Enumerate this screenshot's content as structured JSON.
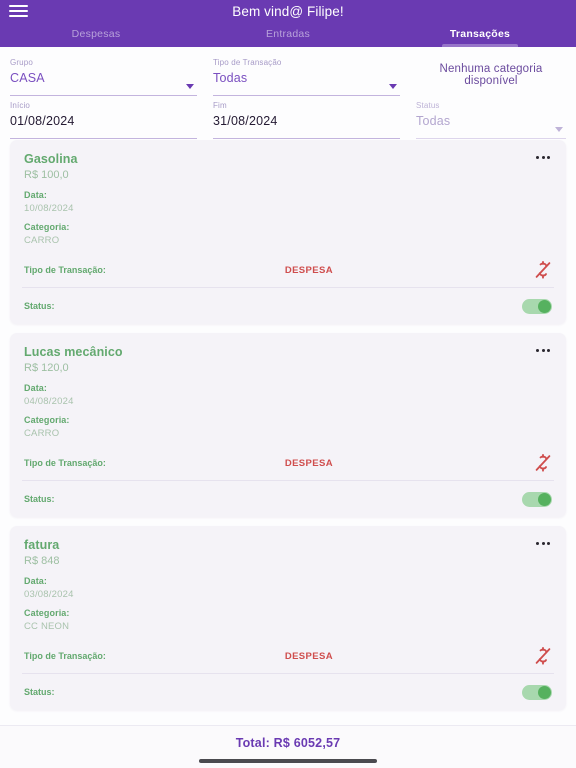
{
  "appbar": {
    "menu_icon": "hamburger-menu-icon",
    "title": "Bem vind@ Filipe!",
    "background_color": "#6a3ab2"
  },
  "tabs": [
    {
      "label": "Despesas",
      "active": false
    },
    {
      "label": "Entradas",
      "active": false
    },
    {
      "label": "Transações",
      "active": true
    }
  ],
  "filters": {
    "grupo": {
      "label": "Grupo",
      "value": "CASA",
      "icon": "chevron-down-icon"
    },
    "tipo": {
      "label": "Tipo de Transação",
      "value": "Todas",
      "icon": "chevron-down-icon"
    },
    "categoria_message": "Nenhuma categoria disponível",
    "inicio": {
      "label": "Início",
      "value": "01/08/2024"
    },
    "fim": {
      "label": "Fim",
      "value": "31/08/2024"
    },
    "status": {
      "label": "Status",
      "value": "Todas",
      "icon": "chevron-down-icon"
    }
  },
  "labels": {
    "data": "Data:",
    "categoria": "Categoria:",
    "tipo_transacao": "Tipo de Transação:",
    "status": "Status:"
  },
  "transactions": [
    {
      "title": "Gasolina",
      "amount": "R$ 100,0",
      "date": "10/08/2024",
      "category": "CARRO",
      "type": "DESPESA",
      "status_on": true,
      "type_icon": "money-off-icon",
      "menu_icon": "more-horizontal-icon"
    },
    {
      "title": "Lucas mecânico",
      "amount": "R$ 120,0",
      "date": "04/08/2024",
      "category": "CARRO",
      "type": "DESPESA",
      "status_on": true,
      "type_icon": "money-off-icon",
      "menu_icon": "more-horizontal-icon"
    },
    {
      "title": "fatura",
      "amount": "R$ 848",
      "date": "03/08/2024",
      "category": "CC NEON",
      "type": "DESPESA",
      "status_on": true,
      "type_icon": "money-off-icon",
      "menu_icon": "more-horizontal-icon"
    }
  ],
  "footer": {
    "total": "Total: R$ 6052,57"
  },
  "colors": {
    "primary": "#6a3ab2",
    "card": "#f5f3f8",
    "accent_green": "#63a96f",
    "expense_red": "#cf4d4d"
  }
}
